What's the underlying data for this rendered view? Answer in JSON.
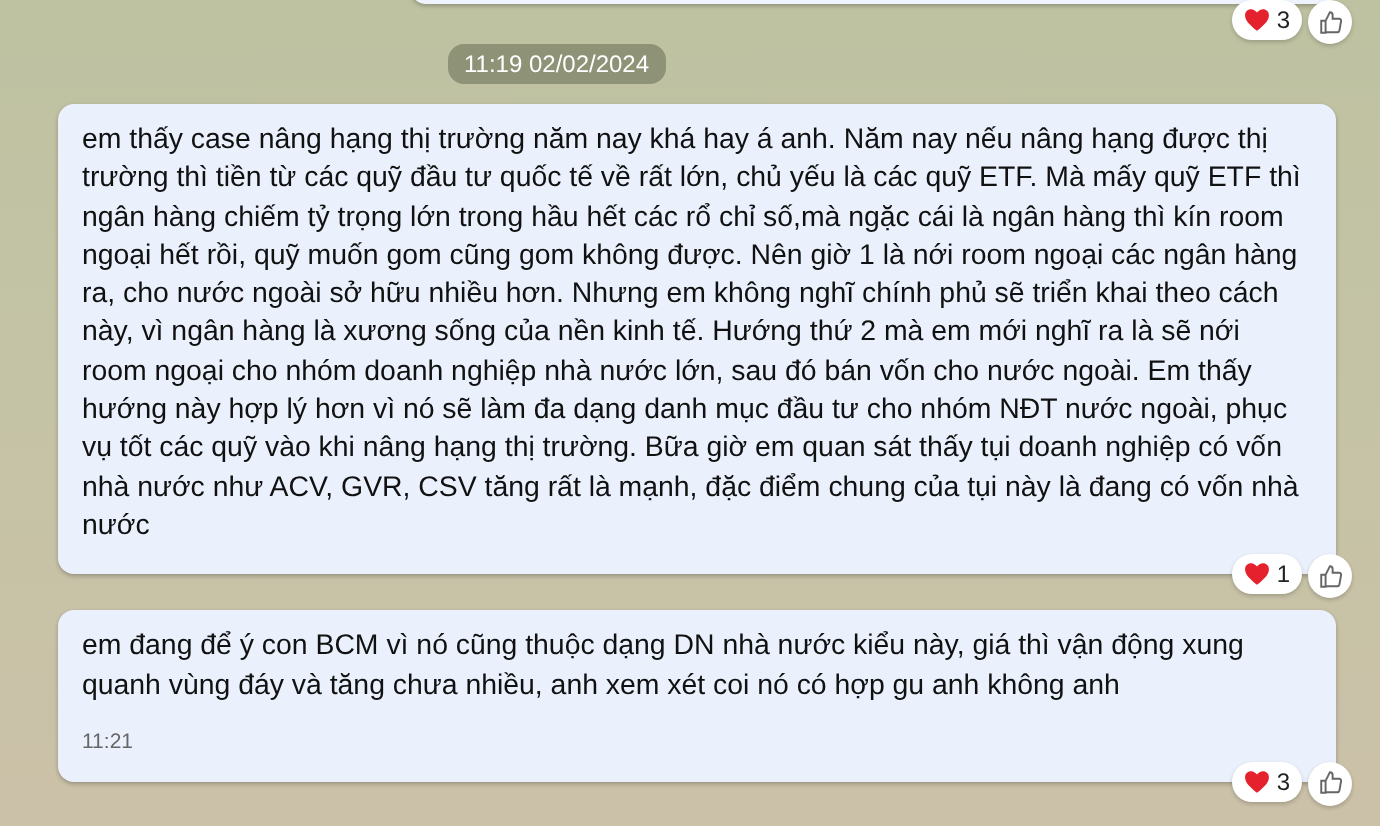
{
  "previous_message": {
    "reaction": {
      "count": "3"
    }
  },
  "date_separator": "11:19 02/02/2024",
  "messages": [
    {
      "text": "em thấy case nâng hạng thị trường năm nay khá hay á anh. Năm nay nếu nâng hạng được thị trường thì tiền từ các quỹ đầu tư quốc tế về rất lớn, chủ yếu là các quỹ ETF. Mà mấy quỹ ETF thì ngân hàng chiếm tỷ trọng lớn trong hầu hết các rổ chỉ số,mà ngặc cái là ngân hàng thì kín room ngoại hết rồi, quỹ muốn gom cũng gom không được. Nên giờ 1 là nới room ngoại các ngân hàng ra, cho nước ngoài sở hữu nhiều hơn. Nhưng em không nghĩ chính phủ sẽ triển khai theo cách này, vì ngân hàng là xương sống của nền kinh tế. Hướng thứ 2 mà em mới nghĩ ra là sẽ nới room ngoại cho nhóm doanh nghiệp nhà nước lớn, sau đó bán vốn cho nước ngoài. Em thấy hướng này hợp lý hơn vì nó sẽ làm đa dạng danh mục đầu tư cho nhóm NĐT nước ngoài, phục vụ tốt các quỹ vào khi nâng hạng thị trường. Bữa giờ em quan sát thấy tụi doanh nghiệp có vốn nhà nước như ACV, GVR, CSV tăng rất là mạnh, đặc điểm chung của tụi này là đang có vốn nhà nước",
      "reaction": {
        "count": "1"
      }
    },
    {
      "text": "em đang để ý con BCM vì nó cũng thuộc dạng DN nhà nước kiểu này, giá thì vận động xung quanh vùng đáy và tăng chưa nhiều, anh xem xét coi nó có hợp gu anh không anh",
      "time": "11:21",
      "reaction": {
        "count": "3"
      }
    }
  ]
}
